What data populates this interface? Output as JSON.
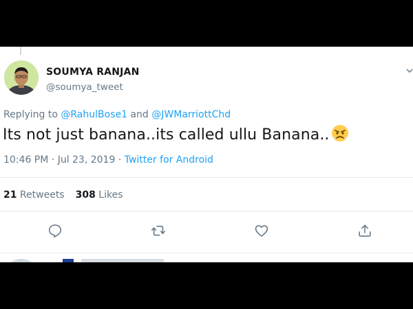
{
  "tweet": {
    "author": {
      "display_name": "SOUMYA RANJAN",
      "handle": "@soumya_tweet",
      "avatar_icon": "user-avatar"
    },
    "reply_context": {
      "prefix": "Replying to ",
      "mention_1": "@RahulBose1",
      "conjunction": " and ",
      "mention_2": "@JWMarriottChd"
    },
    "text": "Its not just banana..its called ullu Banana..",
    "emoji_icon": "angry-face-emoji",
    "time": "10:46 PM",
    "separator": " · ",
    "date": "Jul 23, 2019",
    "source": "Twitter for Android",
    "stats": {
      "retweets_count": "21",
      "retweets_label": " Retweets",
      "likes_count": "308",
      "likes_label": " Likes"
    },
    "actions": [
      "reply-icon",
      "retweet-icon",
      "like-icon",
      "share-icon"
    ]
  },
  "colors": {
    "link": "#1da1f2",
    "secondary_text": "#657786",
    "primary_text": "#14171a",
    "divider": "#e6ecf0"
  }
}
